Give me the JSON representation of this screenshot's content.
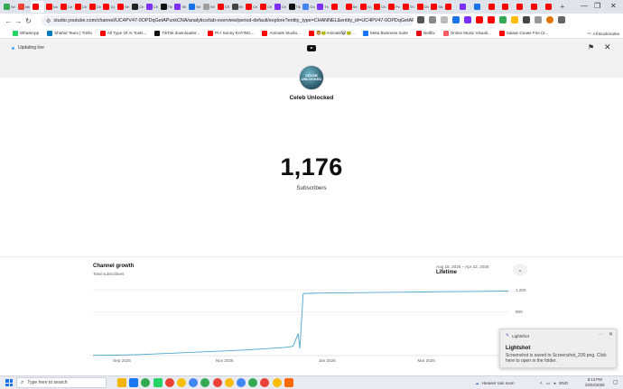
{
  "browser": {
    "tabs": [
      {
        "label": "Se",
        "color": "#34a853"
      },
      {
        "label": "Inb",
        "color": "#ea4335"
      },
      {
        "label": "",
        "color": "#ff0000",
        "active": true
      },
      {
        "label": "ka",
        "color": "#ff0000"
      },
      {
        "label": "Cel",
        "color": "#ff0000"
      },
      {
        "label": "Ch",
        "color": "#ff0000"
      },
      {
        "label": "Ch",
        "color": "#ff0000"
      },
      {
        "label": "(1)",
        "color": "#ff0000"
      },
      {
        "label": "Se",
        "color": "#ff0000"
      },
      {
        "label": "Ch",
        "color": "#222222"
      },
      {
        "label": "Ch",
        "color": "#7b2ff7"
      },
      {
        "label": "TikT",
        "color": "#111111"
      },
      {
        "label": "Sh",
        "color": "#7b2ff7"
      },
      {
        "label": "Se",
        "color": "#1a73e8"
      },
      {
        "label": "Wi",
        "color": "#9e9e9e"
      },
      {
        "label": "CS",
        "color": "#ff0000"
      },
      {
        "label": "Mi",
        "color": "#444444"
      },
      {
        "label": "Cel",
        "color": "#ff0000"
      },
      {
        "label": "Ch",
        "color": "#ff0000"
      },
      {
        "label": "Ch",
        "color": "#7b2ff7"
      },
      {
        "label": "Tik",
        "color": "#111111"
      },
      {
        "label": "Go",
        "color": "#4285f4"
      },
      {
        "label": "Th",
        "color": "#7b2ff7"
      },
      {
        "label": "",
        "color": "#ff0000"
      },
      {
        "label": "Se",
        "color": "#ff0000"
      },
      {
        "label": "(1)",
        "color": "#ff0000"
      },
      {
        "label": "Ch",
        "color": "#ff0000"
      },
      {
        "label": "Pc",
        "color": "#ff0000"
      },
      {
        "label": "Th",
        "color": "#ff0000"
      },
      {
        "label": "Ch",
        "color": "#ff0000"
      },
      {
        "label": "Sea",
        "color": "#ff0000"
      },
      {
        "label": "",
        "color": "#ff0000"
      },
      {
        "label": "",
        "color": "#7b2ff7"
      },
      {
        "label": "",
        "color": "#1a73e8"
      },
      {
        "label": "",
        "color": "#ff0000"
      },
      {
        "label": "",
        "color": "#ff0000"
      },
      {
        "label": "",
        "color": "#ff0000"
      },
      {
        "label": "",
        "color": "#ff0000"
      },
      {
        "label": "",
        "color": "#ff0000"
      }
    ],
    "url": "studio.youtube.com/channel/UC4PV47-0OPDqGetAPunkCNA/analytics/tab-overview/period-default/explore?entity_type=CHANNEL&entity_id=UC4PV47-0OPDqGetAPunkCNA&ti...",
    "window_minimize": "—",
    "window_restore": "❐",
    "window_close": "✕",
    "bookmarks": [
      {
        "label": "WhatsApp",
        "color": "#25d366"
      },
      {
        "label": "Shahid Team | Trello",
        "color": "#0079bf"
      },
      {
        "label": "All Type Of AI Tools...",
        "color": "#ff0000"
      },
      {
        "label": "TikTok downloader...",
        "color": "#111111"
      },
      {
        "label": "PI-I Sunny EATING...",
        "color": "#ff0000"
      },
      {
        "label": "Animals Studio...",
        "color": "#ff0000"
      },
      {
        "label": "🦁🐸Animals🐼🐸...",
        "color": "#ff0000"
      },
      {
        "label": "Meta Business Suite",
        "color": "#1877f2"
      },
      {
        "label": "Netflix",
        "color": "#e50914"
      },
      {
        "label": "Online Music Visuali...",
        "color": "#ff5a5f"
      },
      {
        "label": "Salaar Cease Fire (2...",
        "color": "#ff0000"
      }
    ],
    "all_bookmarks": "All Bookmarks"
  },
  "studio": {
    "status": "Updating live",
    "channel_name": "Celeb Unlocked",
    "avatar_text": "CELEB UNLOCKED",
    "subscriber_count": "1,176",
    "subscriber_label": "Subscribers"
  },
  "chart_card": {
    "title": "Channel growth",
    "subtitle": "Total subscribers",
    "range_dates": "Aug 18, 2025 – Apr 22, 2026",
    "range_label": "Lifetime",
    "chevron": "⌄"
  },
  "chart_data": {
    "type": "line",
    "title": "Channel growth",
    "ylabel": "",
    "xlabel": "",
    "x_ticks": [
      "Sep 2025",
      "Nov 2025",
      "Jan 2026",
      "Mar 2026"
    ],
    "y_ticks": [
      800,
      1200
    ],
    "y_tick_labels": [
      "800",
      "1,200"
    ],
    "ylim": [
      0,
      1250
    ],
    "grid": true,
    "series": [
      {
        "color": "#4aa7c9",
        "x": [
          "2025-08-18",
          "2025-09-01",
          "2025-09-15",
          "2025-10-01",
          "2025-10-15",
          "2025-11-01",
          "2025-11-15",
          "2025-12-01",
          "2025-12-10",
          "2025-12-15",
          "2025-12-18",
          "2025-12-19",
          "2025-12-21",
          "2025-12-25",
          "2026-01-01",
          "2026-01-15",
          "2026-02-01",
          "2026-02-15",
          "2026-03-01",
          "2026-03-15",
          "2026-04-01",
          "2026-04-22"
        ],
        "y": [
          5,
          10,
          20,
          40,
          60,
          80,
          100,
          130,
          150,
          170,
          400,
          130,
          1130,
          1135,
          1140,
          1145,
          1150,
          1155,
          1160,
          1165,
          1170,
          1176
        ]
      }
    ]
  },
  "lightshot": {
    "app_name": "Lightshot",
    "dots": "···",
    "close": "✕",
    "title": "Lightshot",
    "body": "Screenshot is saved to Screenshot_200.png. Click here to open in the folder."
  },
  "taskbar": {
    "search_placeholder": "Type here to search",
    "weather": "Heavier rain soon",
    "language": "ENG",
    "time": "8:13 PM",
    "date": "23/04/2026",
    "apps": [
      {
        "name": "explorer",
        "color": "#f5b400"
      },
      {
        "name": "facebook",
        "color": "#1877f2"
      },
      {
        "name": "chrome",
        "color": "#34a853"
      },
      {
        "name": "whatsapp",
        "color": "#25d366"
      },
      {
        "name": "chrome-2",
        "color": "#ea4335"
      },
      {
        "name": "chrome-3",
        "color": "#fbbc05"
      },
      {
        "name": "chrome-4",
        "color": "#4285f4"
      },
      {
        "name": "chrome-5",
        "color": "#34a853"
      },
      {
        "name": "chrome-6",
        "color": "#ea4335"
      },
      {
        "name": "chrome-7",
        "color": "#fbbc05"
      },
      {
        "name": "chrome-8",
        "color": "#4285f4"
      },
      {
        "name": "chrome-9",
        "color": "#34a853"
      },
      {
        "name": "chrome-10",
        "color": "#ea4335"
      },
      {
        "name": "chrome-11",
        "color": "#fbbc05"
      },
      {
        "name": "lightshot-app",
        "color": "#ff6a00"
      }
    ]
  }
}
